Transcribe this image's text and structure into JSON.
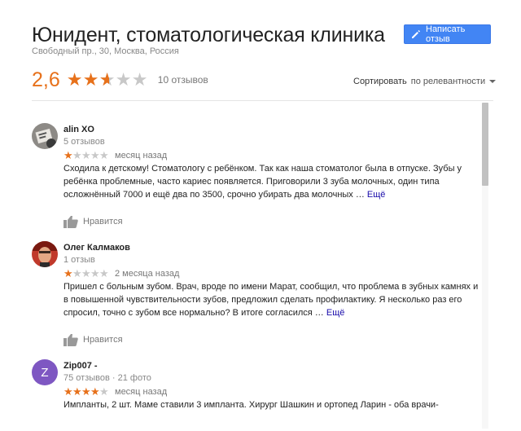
{
  "header": {
    "title": "Юнидент, стоматологическая клиника",
    "address": "Свободный пр., 30, Москва, Россия",
    "write_review_label": "Написать отзыв"
  },
  "rating": {
    "value": "2,6",
    "stars_filled": 2.6,
    "reviews_count": "10 отзывов"
  },
  "sort": {
    "label": "Сортировать",
    "value": "по релевантности"
  },
  "reviews": [
    {
      "author": "alin XO",
      "meta": "5 отзывов",
      "stars": 1,
      "time": "месяц назад",
      "text": "Сходила к детскому! Стоматологу с ребёнком. Так как наша стоматолог была в отпуске. Зубы у ребёнка проблемные, часто кариес появляется. Приговорили 3 зуба молочных, один типа осложнённый 7000 и ещё два по 3500, срочно убирать два молочных …",
      "more": "Ещё",
      "like": "Нравится"
    },
    {
      "author": "Олег Калмаков",
      "meta": "1 отзыв",
      "stars": 1,
      "time": "2 месяца назад",
      "text": "Пришел с больным зубом. Врач, вроде по имени Марат, сообщил, что проблема в зубных камнях и в повышенной чувствительности зубов, предложил сделать профилактику. Я несколько раз его спросил, точно с зубом все нормально? В итоге согласился …",
      "more": "Ещё",
      "like": "Нравится"
    },
    {
      "author": "Zip007 -",
      "meta": "75 отзывов · 21 фото",
      "avatar_letter": "Z",
      "stars": 4,
      "time": "месяц назад",
      "text": "Импланты, 2 шт. Маме ставили 3 импланта. Хирург Шашкин и ортопед Ларин - оба врачи-"
    }
  ],
  "colors": {
    "accent": "#4285f4",
    "star": "#e7711b",
    "link": "#1a0dab"
  }
}
